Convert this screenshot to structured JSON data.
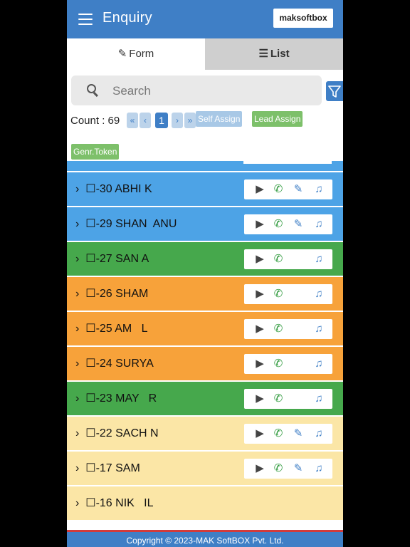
{
  "header": {
    "title": "Enquiry",
    "logo": "maksoftbox"
  },
  "tabs": {
    "form": "Form",
    "list": "List"
  },
  "search": {
    "placeholder": "Search"
  },
  "toolbar": {
    "count": "Count : 69",
    "first": "«",
    "prev": "‹",
    "page": "1",
    "next": "›",
    "last": "»",
    "self_assign": "Self Assign",
    "lead_assign": "Lead Assign",
    "genr_token": "Genr.Token"
  },
  "colors": {
    "primary": "#3f7fc6",
    "blue_row": "#4da3e6",
    "green_row": "#46a84c",
    "orange_row": "#f7a23a",
    "yellow_row": "#fbe6a6",
    "action_green": "#7dc06a"
  },
  "rows": [
    {
      "label": "›  ☐-30 ABHI K",
      "color": "#4da3e6",
      "actions": [
        "play-icon",
        "call-icon",
        "edit-icon",
        "music-icon"
      ]
    },
    {
      "label": "›  ☐-29 SHAN  ANU",
      "color": "#4da3e6",
      "actions": [
        "play-icon",
        "call-icon",
        "edit-icon",
        "music-icon"
      ]
    },
    {
      "label": "›  ☐-27 SAN A",
      "color": "#46a84c",
      "actions": [
        "play-icon",
        "call-icon",
        "music-icon"
      ]
    },
    {
      "label": "›  ☐-26 SHAM",
      "color": "#f7a23a",
      "actions": [
        "play-icon",
        "call-icon",
        "music-icon"
      ]
    },
    {
      "label": "›  ☐-25 AM   L",
      "color": "#f7a23a",
      "actions": [
        "play-icon",
        "call-icon",
        "music-icon"
      ]
    },
    {
      "label": "›  ☐-24 SURYA",
      "color": "#f7a23a",
      "actions": [
        "play-icon",
        "call-icon",
        "music-icon"
      ]
    },
    {
      "label": "›  ☐-23 MAY   R",
      "color": "#46a84c",
      "actions": [
        "play-icon",
        "call-icon",
        "music-icon"
      ]
    },
    {
      "label": "›  ☐-22 SACH N",
      "color": "#fbe6a6",
      "actions": [
        "play-icon",
        "call-icon",
        "edit-icon",
        "music-icon"
      ]
    },
    {
      "label": "›  ☐-17 SAM",
      "color": "#fbe6a6",
      "actions": [
        "play-icon",
        "call-icon",
        "edit-icon",
        "music-icon"
      ]
    },
    {
      "label": "›  ☐-16 NIK   IL",
      "color": "#fbe6a6",
      "actions": []
    }
  ],
  "footer": {
    "copyright": "Copyright © 2023-MAK SoftBOX Pvt. Ltd."
  }
}
